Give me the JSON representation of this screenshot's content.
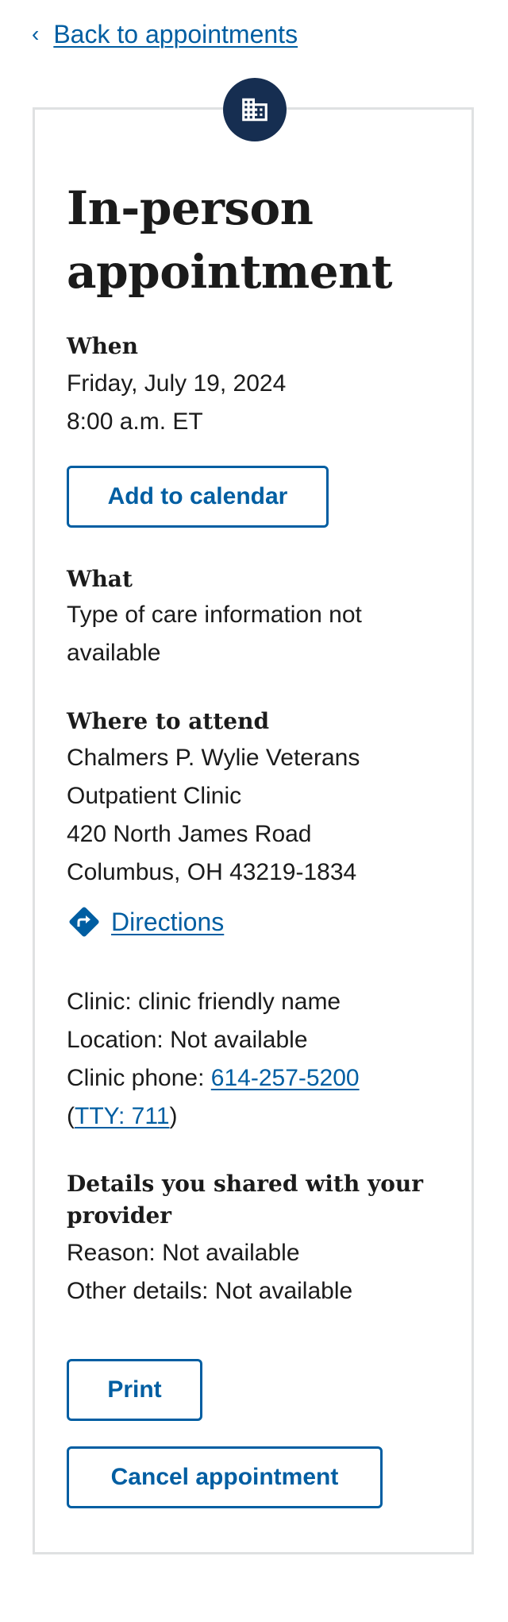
{
  "nav": {
    "back_chevron": "‹",
    "back_label": "Back to appointments"
  },
  "appointment": {
    "icon": "building-icon",
    "title_line1": "In-person",
    "title_line2": "appointment",
    "when": {
      "heading": "When",
      "date": "Friday, July 19, 2024",
      "time": "8:00 a.m. ET",
      "calendar_button": "Add to calendar"
    },
    "what": {
      "heading": "What",
      "line1": "Type of care information not",
      "line2": "available"
    },
    "where": {
      "heading": "Where to attend",
      "name_line1": "Chalmers P. Wylie Veterans",
      "name_line2": "Outpatient Clinic",
      "street": "420 North James Road",
      "city_state_zip": "Columbus, OH 43219-1834",
      "directions_icon": "directions-icon",
      "directions_label": "Directions"
    },
    "clinic": {
      "name_label": "Clinic: clinic friendly name",
      "location_label": "Location: Not available",
      "phone_prefix": "Clinic phone: ",
      "phone": "614-257-5200",
      "tty_open": "(",
      "tty": "TTY: 711",
      "tty_close": ")"
    },
    "details": {
      "heading_line1": "Details you shared with your",
      "heading_line2": "provider",
      "reason": "Reason: Not available",
      "other": "Other details: Not available"
    },
    "actions": {
      "print": "Print",
      "cancel": "Cancel appointment"
    }
  },
  "colors": {
    "link": "#005ea2",
    "icon_circle": "#162e51",
    "border": "#dfe1e2",
    "text": "#1b1b1b"
  }
}
